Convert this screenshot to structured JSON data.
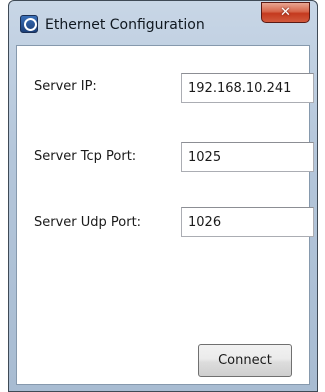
{
  "window": {
    "title": "Ethernet Configuration",
    "icon": "network-app-icon",
    "close_glyph": "✕"
  },
  "form": {
    "server_ip": {
      "label": "Server IP:",
      "value": "192.168.10.241"
    },
    "server_tcp_port": {
      "label": "Server Tcp Port:",
      "value": "1025"
    },
    "server_udp_port": {
      "label": "Server Udp Port:",
      "value": "1026"
    }
  },
  "actions": {
    "connect_label": "Connect"
  },
  "colors": {
    "close_button": "#c4391e",
    "titlebar": "#b4c6da"
  }
}
